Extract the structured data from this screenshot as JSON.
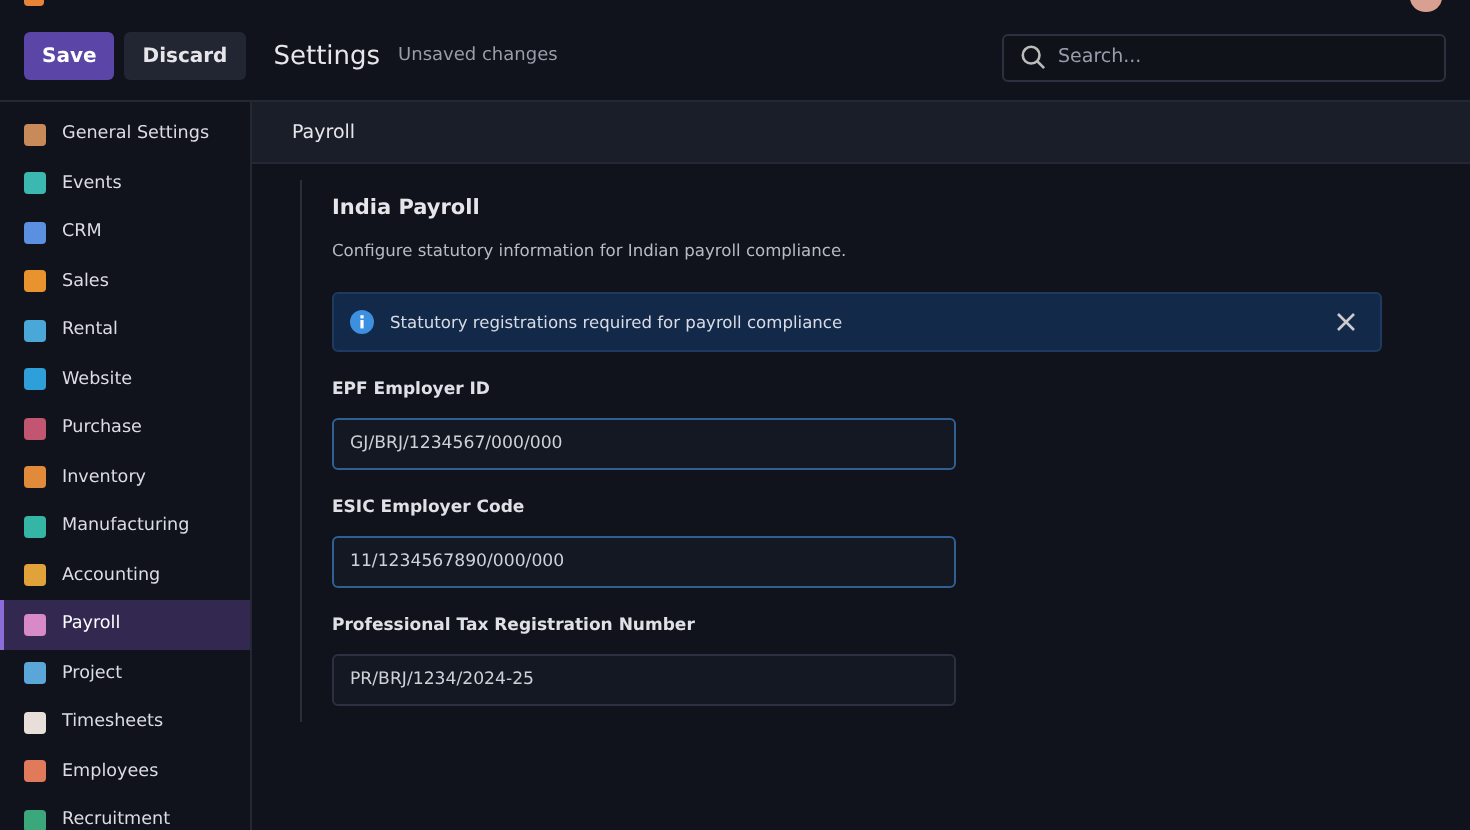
{
  "header": {
    "save": "Save",
    "discard": "Discard",
    "title": "Settings",
    "status": "Unsaved changes",
    "search": {
      "placeholder": "Search..."
    }
  },
  "sidebar": {
    "items": [
      {
        "label": "General Settings",
        "color": "#c98a5a",
        "selected": false
      },
      {
        "label": "Events",
        "color": "#3bb8b0",
        "selected": false
      },
      {
        "label": "CRM",
        "color": "#5b8fe0",
        "selected": false
      },
      {
        "label": "Sales",
        "color": "#e8932e",
        "selected": false
      },
      {
        "label": "Rental",
        "color": "#4aa8d8",
        "selected": false
      },
      {
        "label": "Website",
        "color": "#2e9fd8",
        "selected": false
      },
      {
        "label": "Purchase",
        "color": "#c25570",
        "selected": false
      },
      {
        "label": "Inventory",
        "color": "#e08a3a",
        "selected": false
      },
      {
        "label": "Manufacturing",
        "color": "#35b5a5",
        "selected": false
      },
      {
        "label": "Accounting",
        "color": "#e2a23a",
        "selected": false
      },
      {
        "label": "Payroll",
        "color": "#d889c8",
        "selected": true
      },
      {
        "label": "Project",
        "color": "#5aa6d8",
        "selected": false
      },
      {
        "label": "Timesheets",
        "color": "#e8e0d8",
        "selected": false
      },
      {
        "label": "Employees",
        "color": "#e07a5a",
        "selected": false
      },
      {
        "label": "Recruitment",
        "color": "#3aa87a",
        "selected": false
      }
    ]
  },
  "section": {
    "title": "Payroll",
    "heading": "India Payroll",
    "description": "Configure statutory information for Indian payroll compliance.",
    "alert": "Statutory registrations required for payroll compliance",
    "fields": [
      {
        "label": "EPF Employer ID",
        "value": "GJ/BRJ/1234567/000/000",
        "focused": true
      },
      {
        "label": "ESIC Employer Code",
        "value": "11/1234567890/000/000",
        "focused": true
      },
      {
        "label": "Professional Tax Registration Number",
        "value": "PR/BRJ/1234/2024-25",
        "focused": false
      }
    ]
  }
}
